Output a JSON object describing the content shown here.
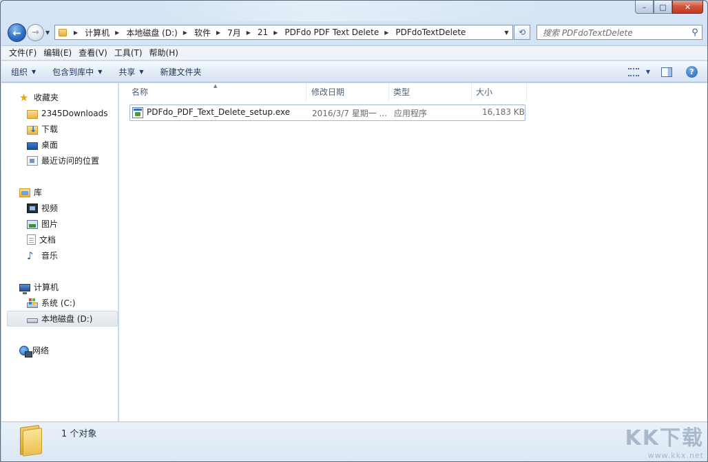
{
  "window": {
    "caption_buttons": {
      "minimize": "–",
      "maximize": "□",
      "close": "✕"
    }
  },
  "nav": {
    "back_glyph": "←",
    "forward_glyph": "→",
    "breadcrumbs": [
      "计算机",
      "本地磁盘 (D:)",
      "软件",
      "7月",
      "21",
      "PDFdo PDF Text Delete",
      "PDFdoTextDelete"
    ],
    "search_placeholder": "搜索 PDFdoTextDelete"
  },
  "menubar": {
    "items": [
      "文件(F)",
      "编辑(E)",
      "查看(V)",
      "工具(T)",
      "帮助(H)"
    ]
  },
  "commandbar": {
    "organize": "组织",
    "include_in_library": "包含到库中",
    "share": "共享",
    "new_folder": "新建文件夹",
    "help_glyph": "?"
  },
  "sidebar": {
    "favorites": {
      "label": "收藏夹",
      "items": [
        "2345Downloads",
        "下载",
        "桌面",
        "最近访问的位置"
      ]
    },
    "libraries": {
      "label": "库",
      "items": [
        "视频",
        "图片",
        "文档",
        "音乐"
      ]
    },
    "computer": {
      "label": "计算机",
      "items": [
        "系统 (C:)",
        "本地磁盘 (D:)"
      ],
      "selected": "本地磁盘 (D:)"
    },
    "network": {
      "label": "网络"
    }
  },
  "columns": {
    "name": "名称",
    "modified": "修改日期",
    "type": "类型",
    "size": "大小"
  },
  "files": [
    {
      "name": "PDFdo_PDF_Text_Delete_setup.exe",
      "modified": "2016/3/7 星期一 ...",
      "type": "应用程序",
      "size": "16,183 KB"
    }
  ],
  "status": {
    "item_count": "1 个对象"
  },
  "watermark": {
    "main": "KK下载",
    "url": "www.kkx.net"
  },
  "colors": {
    "frame": "#c4d8ee",
    "selection_border": "#9db7d6",
    "link_blue": "#1e3657"
  }
}
